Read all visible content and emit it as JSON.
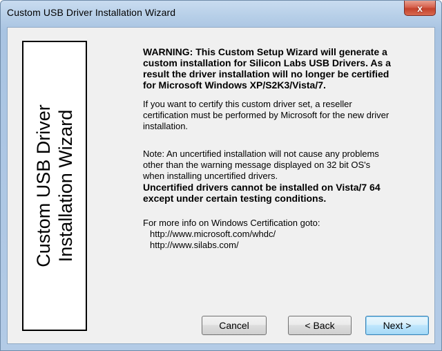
{
  "window": {
    "title": "Custom USB Driver Installation Wizard",
    "close_glyph": "x"
  },
  "banner": {
    "line1": "Custom USB Driver",
    "line2": "Installation Wizard"
  },
  "content": {
    "warning": "WARNING: This Custom Setup Wizard will generate a custom installation for Silicon Labs USB Drivers. As a result the driver installation will no longer be certified for Microsoft Windows XP/S2K3/Vista/7.",
    "certify_text": "If you want to certify this custom driver set, a reseller certification must be performed by Microsoft for the new driver installation.",
    "note_text": "Note: An uncertified installation will not cause any problems other than the warning message displayed on 32 bit OS's when installing uncertified drivers.",
    "uncertified_warning": "Uncertified drivers cannot be installed on Vista/7 64 except under certain testing conditions.",
    "more_info": "For more info on Windows Certification goto:",
    "links": [
      "http://www.microsoft.com/whdc/",
      "http://www.silabs.com/"
    ]
  },
  "buttons": {
    "cancel": "Cancel",
    "back": "< Back",
    "next": "Next >"
  }
}
